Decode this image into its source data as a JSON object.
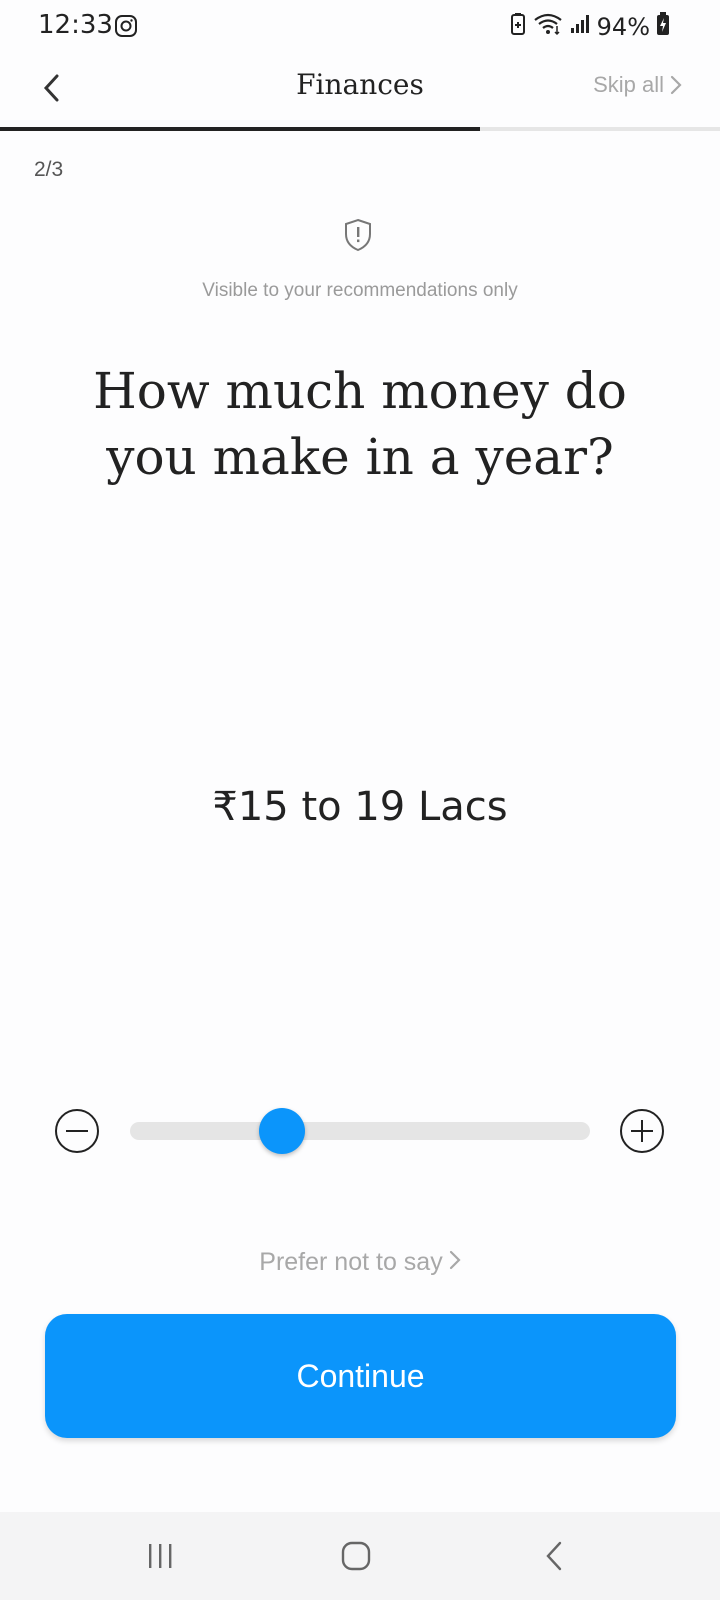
{
  "status_bar": {
    "time": "12:33",
    "battery_percent": "94%",
    "icons": [
      "instagram-icon",
      "battery-saver-icon",
      "wifi-icon",
      "signal-icon",
      "battery-icon"
    ]
  },
  "header": {
    "title": "Finances",
    "skip_label": "Skip all",
    "progress": 0.666
  },
  "step_counter": "2/3",
  "privacy_note": "Visible to your recommendations only",
  "question": "How much money do you make in a year?",
  "selected_value": "₹15 to 19 Lacs",
  "slider": {
    "position": 0.33
  },
  "prefer_not_label": "Prefer not to say",
  "continue_label": "Continue",
  "colors": {
    "accent": "#0B95FB",
    "text": "#222222",
    "muted": "#A8A8A8"
  }
}
